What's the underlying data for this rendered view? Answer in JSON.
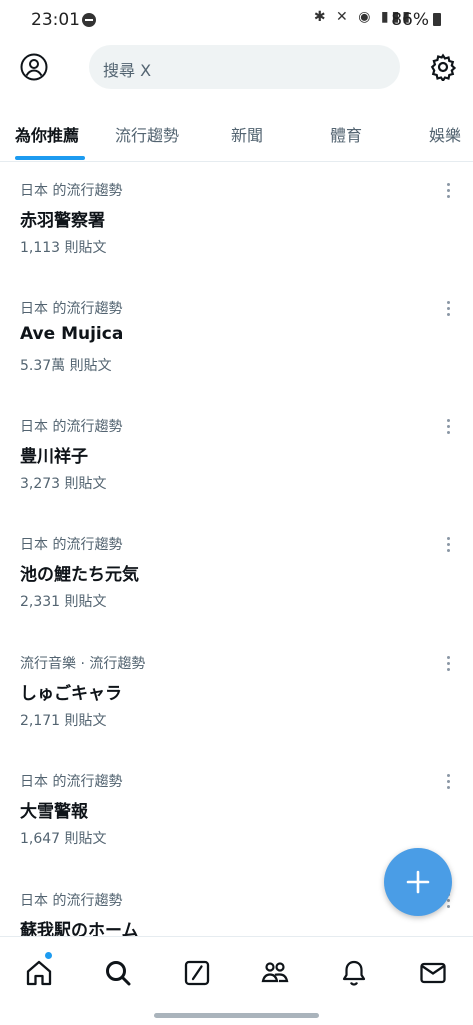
{
  "status_bar": {
    "time": "23:01",
    "icons": "✱ ✕ ◉ ▮▮▮",
    "battery": "86%"
  },
  "search": {
    "placeholder": "搜尋 X"
  },
  "tabs": [
    "為你推薦",
    "流行趨勢",
    "新聞",
    "體育",
    "娛樂"
  ],
  "trends": [
    {
      "context": "日本 的流行趨勢",
      "name": "赤羽警察署",
      "count": "1,113 則貼文"
    },
    {
      "context": "日本 的流行趨勢",
      "name": "Ave Mujica",
      "count": "5.37萬 則貼文"
    },
    {
      "context": "日本 的流行趨勢",
      "name": "豊川祥子",
      "count": "3,273 則貼文"
    },
    {
      "context": "日本 的流行趨勢",
      "name": "池の鯉たち元気",
      "count": "2,331 則貼文"
    },
    {
      "context": "流行音樂 · 流行趨勢",
      "name": "しゅごキャラ",
      "count": "2,171 則貼文"
    },
    {
      "context": "日本 的流行趨勢",
      "name": "大雪警報",
      "count": "1,647 則貼文"
    },
    {
      "context": "日本 的流行趨勢",
      "name": "蘇我駅のホーム",
      "count": ""
    }
  ],
  "bottom_nav": [
    "home-icon",
    "search-icon",
    "grok-icon",
    "communities-icon",
    "notifications-icon",
    "messages-icon"
  ],
  "colors": {
    "accent": "#1d9bf0",
    "fab": "#4a9de6",
    "secondary_text": "#536471"
  }
}
